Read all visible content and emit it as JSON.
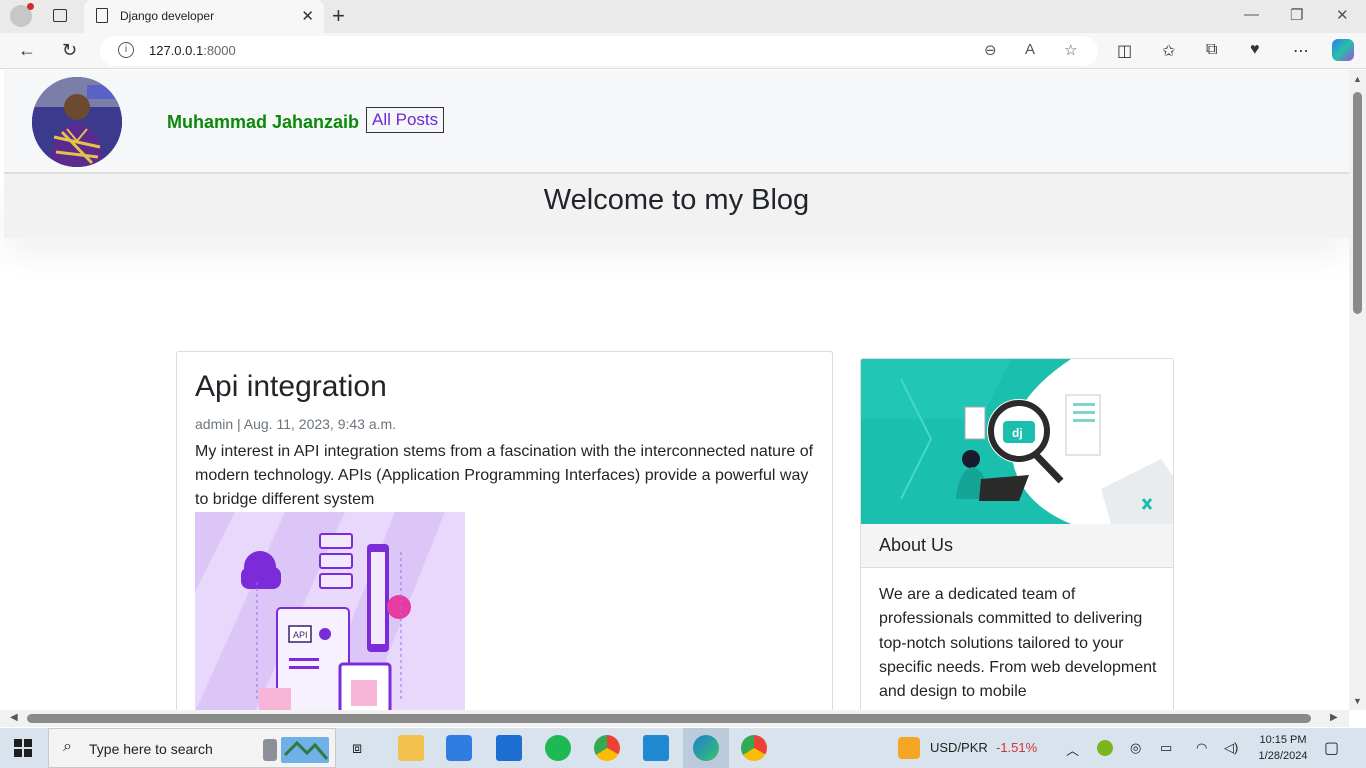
{
  "browser": {
    "tab_title": "Django developer",
    "url_host": "127.0.0.1",
    "url_port": ":8000"
  },
  "site": {
    "author_name": "Muhammad Jahanzaib",
    "all_posts_label": "All Posts",
    "welcome_heading": "Welcome to my Blog"
  },
  "post": {
    "title": "Api integration",
    "meta": "admin | Aug. 11, 2023, 9:43 a.m.",
    "excerpt": "My interest in API integration stems from a fascination with the interconnected nature of modern technology. APIs (Application Programming Interfaces) provide a powerful way to bridge different system",
    "image_label": "API"
  },
  "sidebar": {
    "heading": "About Us",
    "text": "We are a dedicated team of professionals committed to delivering top-notch solutions tailored to your specific needs. From web development and design to mobile",
    "image_badge": "dj"
  },
  "taskbar": {
    "search_placeholder": "Type here to search",
    "ticker_name": "USD/PKR",
    "ticker_change": "-1.51%",
    "time": "10:15 PM",
    "date": "1/28/2024"
  },
  "colors": {
    "author": "#0a8a0a",
    "link": "#6c2bd9",
    "ticker_negative": "#d13438"
  }
}
